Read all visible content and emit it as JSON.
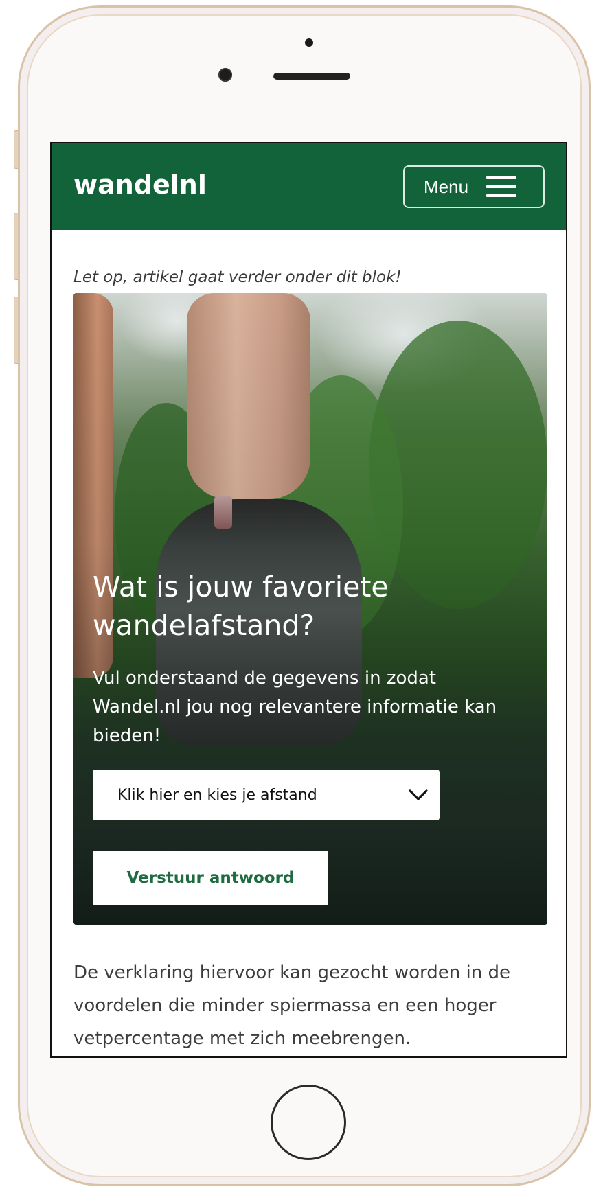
{
  "site": {
    "logo": "wandelnl",
    "menu_label": "Menu"
  },
  "notice": "Let op, artikel gaat verder onder dit blok!",
  "poll": {
    "title": "Wat is jouw favoriete wandelafstand?",
    "subtitle": "Vul onderstaand de gegevens in zodat Wandel.nl jou nog relevantere informatie kan bieden!",
    "select_placeholder": "Klik hier en kies je afstand",
    "submit_label": "Verstuur antwoord"
  },
  "article": {
    "paragraph": "De verklaring hiervoor kan gezocht worden in de voordelen die minder spiermassa en een hoger vetpercentage met zich meebrengen."
  },
  "colors": {
    "brand_green": "#13633a",
    "button_text_green": "#1e6b41"
  },
  "icons": {
    "menu": "hamburger-icon",
    "select": "chevron-down-icon"
  }
}
